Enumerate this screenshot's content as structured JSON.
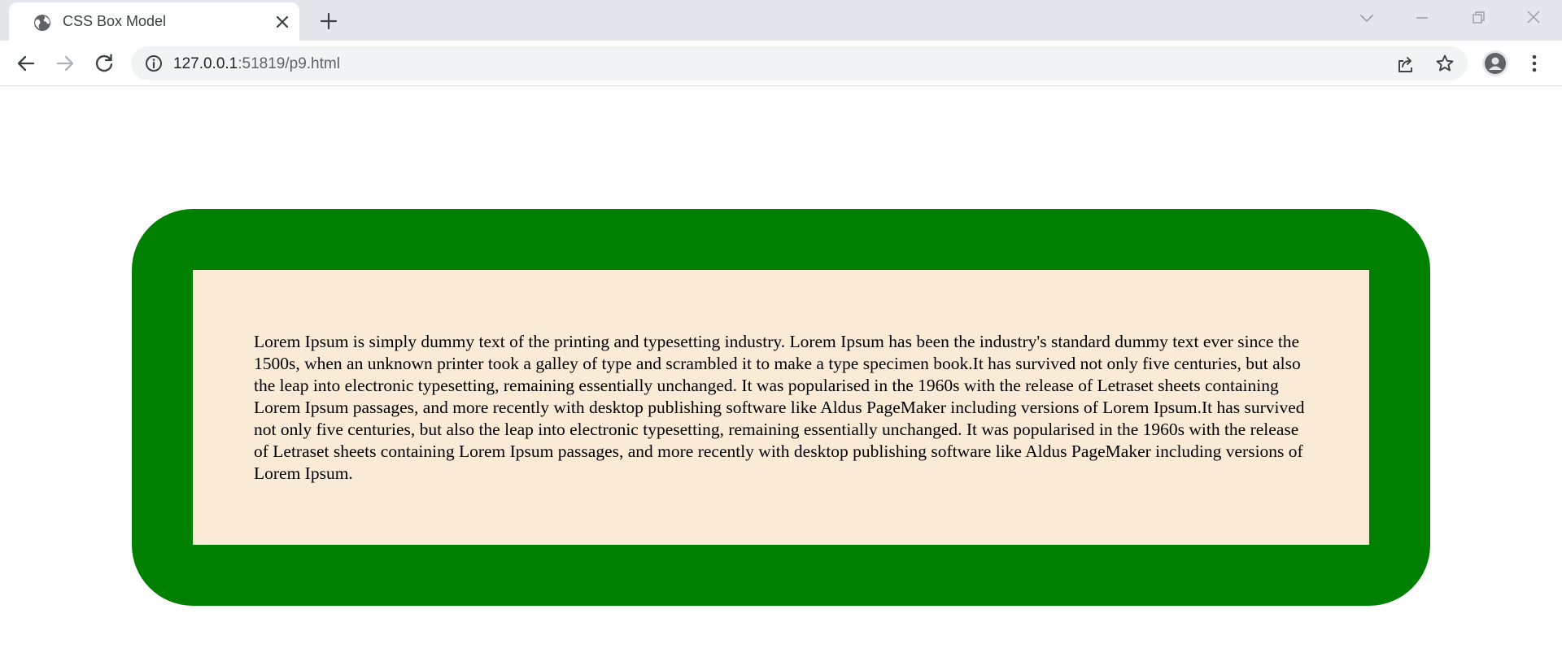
{
  "tab": {
    "title": "CSS Box Model",
    "favicon": "globe-icon"
  },
  "address_bar": {
    "url_host": "127.0.0.1",
    "url_rest": ":51819/p9.html"
  },
  "content": {
    "paragraph": "Lorem Ipsum is simply dummy text of the printing and typesetting industry. Lorem Ipsum has been the industry's standard dummy text ever since the 1500s, when an unknown printer took a galley of type and scrambled it to make a type specimen book.It has survived not only five centuries, but also the leap into electronic typesetting, remaining essentially unchanged. It was popularised in the 1960s with the release of Letraset sheets containing Lorem Ipsum passages, and more recently with desktop publishing software like Aldus PageMaker including versions of Lorem Ipsum.It has survived not only five centuries, but also the leap into electronic typesetting, remaining essentially unchanged. It was popularised in the 1960s with the release of Letraset sheets containing Lorem Ipsum passages, and more recently with desktop publishing software like Aldus PageMaker including versions of Lorem Ipsum."
  },
  "colors": {
    "border": "#008000",
    "background": "#faebd7",
    "tabstrip": "#e3e6ea"
  }
}
